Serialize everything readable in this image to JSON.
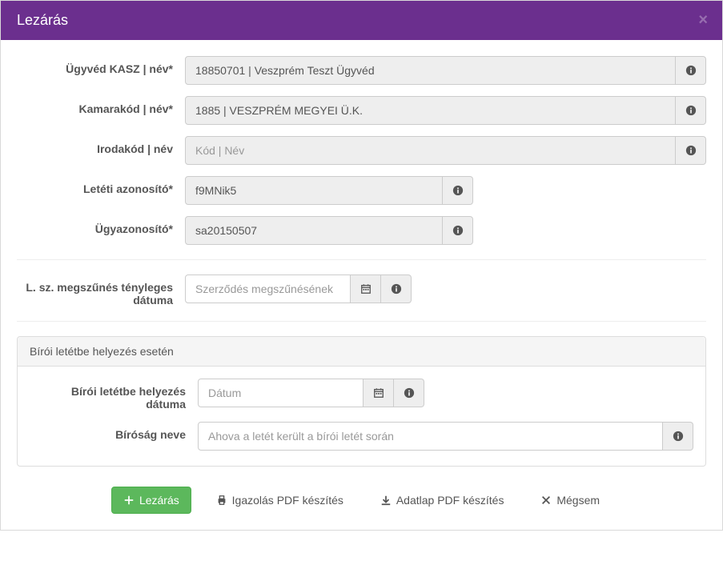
{
  "header": {
    "title": "Lezárás"
  },
  "labels": {
    "ugyved": "Ügyvéd KASZ | név*",
    "kamarakod": "Kamarakód | név*",
    "irodakod": "Irodakód | név",
    "leteti": "Letéti azonosító*",
    "ugy": "Ügyazonosító*",
    "megszunes": "L. sz. megszűnés tényleges dátuma",
    "biroi_datum": "Bírói letétbe helyezés dátuma",
    "birosag": "Bíróság neve"
  },
  "values": {
    "ugyved": "18850701 | Veszprém Teszt Ügyvéd",
    "kamarakod": "1885 | VESZPRÉM MEGYEI Ü.K.",
    "leteti": "f9MNik5",
    "ugy": "sa20150507"
  },
  "placeholders": {
    "irodakod": "Kód | Név",
    "megszunes": "Szerződés megszűnésének",
    "biroi_datum": "Dátum",
    "birosag": "Ahova a letét került a bírói letét során"
  },
  "panel": {
    "heading": "Bírói letétbe helyezés esetén"
  },
  "footer": {
    "lezaras": "Lezárás",
    "igazolas": "Igazolás PDF készítés",
    "adatlap": "Adatlap PDF készítés",
    "megsem": "Mégsem"
  }
}
